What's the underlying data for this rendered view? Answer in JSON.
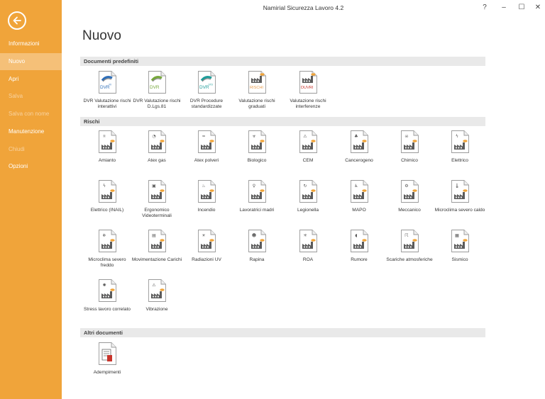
{
  "app_title": "Namirial Sicurezza Lavoro 4.2",
  "window_controls": {
    "help": "?",
    "minimize": "–",
    "maximize": "☐",
    "close": "✕"
  },
  "sidebar": {
    "items": [
      {
        "label": "Informazioni",
        "state": "normal"
      },
      {
        "label": "Nuovo",
        "state": "active"
      },
      {
        "label": "Apri",
        "state": "normal"
      },
      {
        "label": "Salva",
        "state": "disabled"
      },
      {
        "label": "Salva con nome",
        "state": "disabled"
      },
      {
        "label": "Manutenzione",
        "state": "normal"
      },
      {
        "label": "Chiudi",
        "state": "disabled"
      },
      {
        "label": "Opzioni",
        "state": "normal"
      }
    ]
  },
  "page_title": "Nuovo",
  "sections": [
    {
      "title": "Documenti predefiniti",
      "items": [
        {
          "label": "DVR Valutazione rischi interattivi",
          "badge": "DVR",
          "badge_sup": "RI",
          "badge_color": "#2f6fb8",
          "icon": "rainbow-icon"
        },
        {
          "label": "DVR Valutazione rischi D.Lgs.81",
          "badge": "DVR",
          "badge_sup": "",
          "badge_color": "#77a83c",
          "icon": "rainbow-icon"
        },
        {
          "label": "DVR Procedure standardizzate",
          "badge": "DVR",
          "badge_sup": "STD",
          "badge_color": "#1f9d9a",
          "icon": "rainbow-icon"
        },
        {
          "label": "Valutazione rischi graduati",
          "badge": "RISCHI",
          "badge_sup": "",
          "badge_color": "#e89b4a",
          "icon": "factory-icon"
        },
        {
          "label": "Valutazione rischi interferenze",
          "badge": "DUVRI",
          "badge_sup": "",
          "badge_color": "#c8342b",
          "icon": "factory-icon"
        }
      ]
    },
    {
      "title": "Rischi",
      "items": [
        {
          "label": "Amianto",
          "icon": "amianto-icon",
          "glyph": "⚛"
        },
        {
          "label": "Atex gas",
          "icon": "gas-icon",
          "glyph": "◔"
        },
        {
          "label": "Atex polveri",
          "icon": "polveri-icon",
          "glyph": "≈"
        },
        {
          "label": "Biologico",
          "icon": "biologico-icon",
          "glyph": "☣"
        },
        {
          "label": "CEM",
          "icon": "cem-icon",
          "glyph": "⚠"
        },
        {
          "label": "Cancerogeno",
          "icon": "cancerogeno-icon",
          "glyph": "♣"
        },
        {
          "label": "Chimico",
          "icon": "chimico-icon",
          "glyph": "☠"
        },
        {
          "label": "Elettrico",
          "icon": "elettrico-icon",
          "glyph": "ϟ"
        },
        {
          "label": "Elettrico (INAIL)",
          "icon": "elettrico-inail-icon",
          "glyph": "ϟ"
        },
        {
          "label": "Ergonomico Videoterminali",
          "icon": "videoterminale-icon",
          "glyph": "▣"
        },
        {
          "label": "Incendio",
          "icon": "incendio-icon",
          "glyph": "♨"
        },
        {
          "label": "Lavoratrici madri",
          "icon": "madre-icon",
          "glyph": "♀"
        },
        {
          "label": "Legionella",
          "icon": "legionella-icon",
          "glyph": "↻"
        },
        {
          "label": "MAPO",
          "icon": "mapo-icon",
          "glyph": "♿"
        },
        {
          "label": "Meccanico",
          "icon": "meccanico-icon",
          "glyph": "⚙"
        },
        {
          "label": "Microclima severo caldo",
          "icon": "caldo-icon",
          "glyph": "🌡"
        },
        {
          "label": "Microclima severo freddo",
          "icon": "freddo-icon",
          "glyph": "❄"
        },
        {
          "label": "Movimentazione Carichi",
          "icon": "carichi-icon",
          "glyph": "▤"
        },
        {
          "label": "Radiazioni UV",
          "icon": "uv-icon",
          "glyph": "☀"
        },
        {
          "label": "Rapina",
          "icon": "rapina-icon",
          "glyph": "☻"
        },
        {
          "label": "ROA",
          "icon": "roa-icon",
          "glyph": "✳"
        },
        {
          "label": "Rumore",
          "icon": "rumore-icon",
          "glyph": "◖"
        },
        {
          "label": "Scariche atmosferiche",
          "icon": "fulmine-icon",
          "glyph": "☈"
        },
        {
          "label": "Sismico",
          "icon": "sismico-icon",
          "glyph": "▦"
        },
        {
          "label": "Stress lavoro correlato",
          "icon": "stress-icon",
          "glyph": "✺"
        },
        {
          "label": "Vibrazione",
          "icon": "vibrazione-icon",
          "glyph": "⚠"
        }
      ]
    },
    {
      "title": "Altri documenti",
      "items": [
        {
          "label": "Adempimenti",
          "icon": "adempimenti-icon"
        }
      ]
    }
  ],
  "colors": {
    "accent": "#f0a43a",
    "accent_active": "#f5c078",
    "factory": "#5b5b5b",
    "flame": "#f0a43a"
  }
}
